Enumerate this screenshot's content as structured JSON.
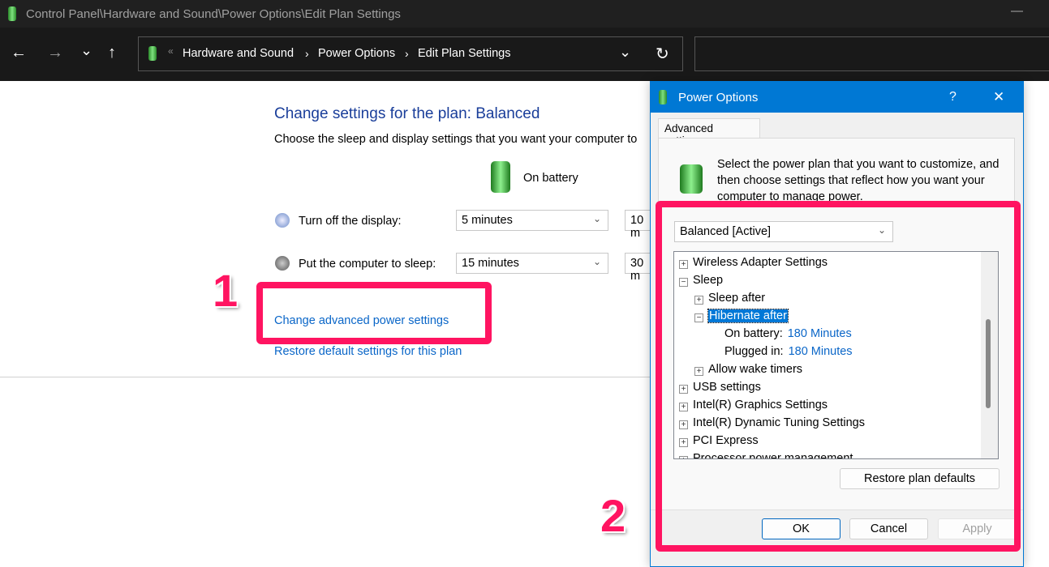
{
  "window": {
    "title": "Control Panel\\Hardware and Sound\\Power Options\\Edit Plan Settings"
  },
  "nav": {
    "back": "←",
    "forward": "→",
    "recent": "⌄",
    "up": "↑",
    "breadcrumb": [
      "Hardware and Sound",
      "Power Options",
      "Edit Plan Settings"
    ],
    "overflow": "«",
    "sep": "›",
    "dropdown": "⌄",
    "refresh": "↻"
  },
  "main": {
    "title": "Change settings for the plan: Balanced",
    "subtitle": "Choose the sleep and display settings that you want your computer to",
    "column_on_battery": "On battery",
    "rows": [
      {
        "label": "Turn off the display:",
        "on_battery": "5 minutes",
        "plugged_in": "10 m"
      },
      {
        "label": "Put the computer to sleep:",
        "on_battery": "15 minutes",
        "plugged_in": "30 m"
      }
    ],
    "advanced_link": "Change advanced power settings",
    "restore_link": "Restore default settings for this plan"
  },
  "annotations": {
    "step1": "1",
    "step2": "2",
    "color": "#ff1461"
  },
  "dialog": {
    "title": "Power Options",
    "help": "?",
    "close": "✕",
    "tab": "Advanced settings",
    "description": "Select the power plan that you want to customize, and then choose settings that reflect how you want your computer to manage power.",
    "plan": "Balanced [Active]",
    "tree": [
      {
        "label": "Wireless Adapter Settings",
        "level": 0,
        "state": "+"
      },
      {
        "label": "Sleep",
        "level": 0,
        "state": "−"
      },
      {
        "label": "Sleep after",
        "level": 1,
        "state": "+"
      },
      {
        "label": "Hibernate after",
        "level": 1,
        "state": "−",
        "selected": true
      },
      {
        "label": "On battery:",
        "value": "180 Minutes",
        "level": 2
      },
      {
        "label": "Plugged in:",
        "value": "180 Minutes",
        "level": 2
      },
      {
        "label": "Allow wake timers",
        "level": 1,
        "state": "+"
      },
      {
        "label": "USB settings",
        "level": 0,
        "state": "+"
      },
      {
        "label": "Intel(R) Graphics Settings",
        "level": 0,
        "state": "+"
      },
      {
        "label": "Intel(R) Dynamic Tuning Settings",
        "level": 0,
        "state": "+"
      },
      {
        "label": "PCI Express",
        "level": 0,
        "state": "+"
      },
      {
        "label": "Processor power management",
        "level": 0,
        "state": "+"
      }
    ],
    "restore_defaults": "Restore plan defaults",
    "ok": "OK",
    "cancel": "Cancel",
    "apply": "Apply"
  },
  "colors": {
    "accent": "#0078d4",
    "link": "#0a66c8",
    "heading": "#1a3e9a"
  }
}
